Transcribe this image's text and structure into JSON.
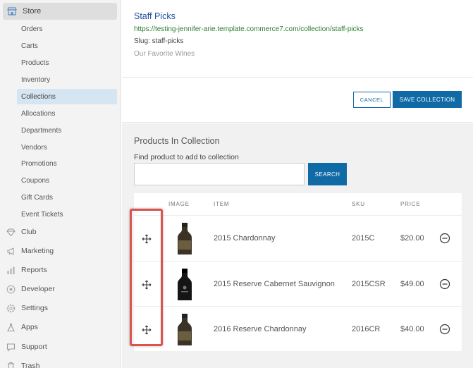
{
  "sidebar": {
    "store_label": "Store",
    "store_items": [
      "Orders",
      "Carts",
      "Products",
      "Inventory",
      "Collections",
      "Allocations",
      "Departments",
      "Vendors",
      "Promotions",
      "Coupons",
      "Gift Cards",
      "Event Tickets"
    ],
    "active_item": "Collections",
    "main_items": [
      {
        "label": "Club",
        "icon": "diamond-icon"
      },
      {
        "label": "Marketing",
        "icon": "megaphone-icon"
      },
      {
        "label": "Reports",
        "icon": "chart-icon"
      },
      {
        "label": "Developer",
        "icon": "developer-icon"
      },
      {
        "label": "Settings",
        "icon": "gear-icon"
      },
      {
        "label": "Apps",
        "icon": "flask-icon"
      },
      {
        "label": "Support",
        "icon": "chat-icon"
      },
      {
        "label": "Trash",
        "icon": "trash-icon"
      }
    ]
  },
  "collection": {
    "title": "Staff Picks",
    "url": "https://testing-jennifer-arie.template.commerce7.com/collection/staff-picks",
    "slug": "Slug: staff-picks",
    "description": "Our Favorite Wines"
  },
  "actions": {
    "cancel_label": "CANCEL",
    "save_label": "SAVE COLLECTION"
  },
  "products_section": {
    "title": "Products In Collection",
    "find_label": "Find product to add to collection",
    "search_value": "",
    "search_button": "SEARCH"
  },
  "table": {
    "headers": {
      "image": "IMAGE",
      "item": "ITEM",
      "sku": "SKU",
      "price": "PRICE"
    },
    "rows": [
      {
        "item": "2015 Chardonnay",
        "sku": "2015C",
        "price": "$20.00",
        "bottle": "light"
      },
      {
        "item": "2015 Reserve Cabernet Sauvignon",
        "sku": "2015CSR",
        "price": "$49.00",
        "bottle": "dark"
      },
      {
        "item": "2016 Reserve Chardonnay",
        "sku": "2016CR",
        "price": "$40.00",
        "bottle": "light"
      }
    ]
  },
  "colors": {
    "primary": "#0f6aa6",
    "link": "#1e4f9c",
    "url": "#2e7d32",
    "highlight": "#d9534f",
    "active_nav": "#d5e5f2"
  }
}
